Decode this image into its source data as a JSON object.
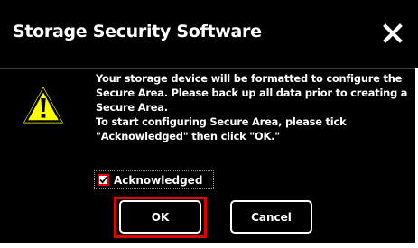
{
  "dialog": {
    "title": "Storage Security Software",
    "close_icon": "close-icon",
    "warning_icon": "warning-icon",
    "message_lines": [
      "Your storage device will be formatted to configure the",
      "Secure Area. Please back up all data prior to creating a",
      "Secure Area.",
      "To start configuring Secure Area, please tick",
      "\"Acknowledged\" then click \"OK.\""
    ],
    "acknowledge": {
      "label": "Acknowledged",
      "checked": true
    },
    "buttons": {
      "ok_label": "OK",
      "cancel_label": "Cancel"
    },
    "colors": {
      "background": "#000000",
      "text": "#ffffff",
      "highlight": "#e00000",
      "warning_fill": "#ffff00"
    }
  }
}
